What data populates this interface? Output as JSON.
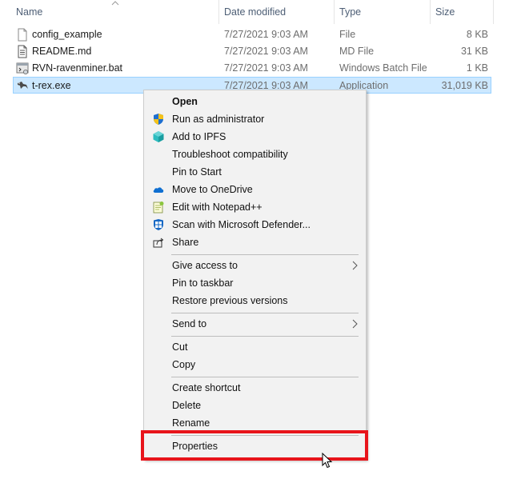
{
  "columns": {
    "name": "Name",
    "date_modified": "Date modified",
    "type": "Type",
    "size": "Size"
  },
  "files": [
    {
      "name": "config_example",
      "date": "7/27/2021 9:03 AM",
      "type": "File",
      "size": "8 KB",
      "icon": "blank-file-icon"
    },
    {
      "name": "README.md",
      "date": "7/27/2021 9:03 AM",
      "type": "MD File",
      "size": "31 KB",
      "icon": "text-file-icon"
    },
    {
      "name": "RVN-ravenminer.bat",
      "date": "7/27/2021 9:03 AM",
      "type": "Windows Batch File",
      "size": "1 KB",
      "icon": "batch-file-icon"
    },
    {
      "name": "t-rex.exe",
      "date": "7/27/2021 9:03 AM",
      "type": "Application",
      "size": "31,019 KB",
      "icon": "trex-app-icon",
      "selected": true
    }
  ],
  "context_menu": {
    "open": "Open",
    "run_as_admin": "Run as administrator",
    "add_to_ipfs": "Add to IPFS",
    "troubleshoot": "Troubleshoot compatibility",
    "pin_to_start": "Pin to Start",
    "move_to_onedrive": "Move to OneDrive",
    "edit_notepad": "Edit with Notepad++",
    "scan_defender": "Scan with Microsoft Defender...",
    "share": "Share",
    "give_access": "Give access to",
    "pin_taskbar": "Pin to taskbar",
    "restore_versions": "Restore previous versions",
    "send_to": "Send to",
    "cut": "Cut",
    "copy": "Copy",
    "create_shortcut": "Create shortcut",
    "delete": "Delete",
    "rename": "Rename",
    "properties": "Properties"
  },
  "colors": {
    "selection": "#cce8ff",
    "highlight_box": "#e8141b",
    "menu_bg": "#f2f2f2"
  }
}
